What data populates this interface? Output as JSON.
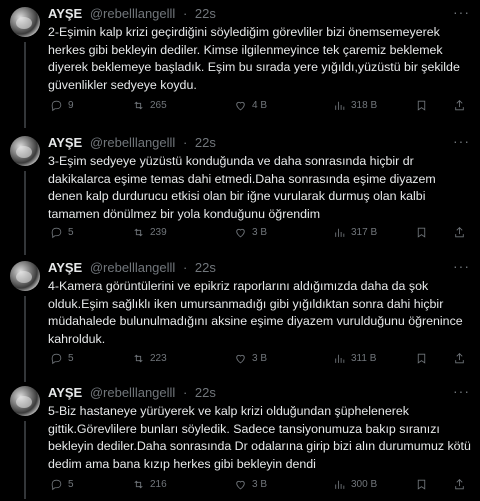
{
  "tweets": [
    {
      "name": "AYŞE",
      "handle": "@rebelllangelll",
      "dot": "·",
      "time": "22s",
      "text": "2-Eşimin kalp krizi geçirdiğini söylediğim görevliler bizi önemsemeyerek herkes gibi bekleyin dediler. Kimse ilgilenmeyince tek çaremiz beklemek diyerek beklemeye başladık. Eşim bu sırada yere yığıldı,yüzüstü bir şekilde güvenlikler sedyeye koydu.",
      "replies": "9",
      "reposts": "265",
      "likes": "4 B",
      "views": "318 B"
    },
    {
      "name": "AYŞE",
      "handle": "@rebelllangelll",
      "dot": "·",
      "time": "22s",
      "text": "3-Eşim sedyeye yüzüstü konduğunda ve daha sonrasında hiçbir dr dakikalarca eşime temas dahi etmedi.Daha sonrasında eşime diyazem denen kalp durdurucu etkisi olan bir iğne vurularak durmuş olan kalbi tamamen dönülmez bir yola konduğunu öğrendim",
      "replies": "5",
      "reposts": "239",
      "likes": "3 B",
      "views": "317 B"
    },
    {
      "name": "AYŞE",
      "handle": "@rebelllangelll",
      "dot": "·",
      "time": "22s",
      "text": "4-Kamera görüntülerini ve epikriz raporlarını aldığımızda daha da şok olduk.Eşim sağlıklı iken umursanmadığı gibi yığıldıktan sonra dahi hiçbir müdahalede bulunulmadığını aksine eşime diyazem vurulduğunu öğrenince kahrolduk.",
      "replies": "5",
      "reposts": "223",
      "likes": "3 B",
      "views": "311 B"
    },
    {
      "name": "AYŞE",
      "handle": "@rebelllangelll",
      "dot": "·",
      "time": "22s",
      "text": "5-Biz hastaneye yürüyerek ve kalp krizi olduğundan şüphelenerek gittik.Görevlilere bunları söyledik. Sadece tansiyonumuza bakıp sıranızı bekleyin dediler.Daha sonrasında Dr odalarına girip bizi alın durumumuz kötü dedim ama bana kızıp herkes gibi bekleyin dendi",
      "replies": "5",
      "reposts": "216",
      "likes": "3 B",
      "views": "300 B"
    }
  ],
  "icons": {
    "reply": "reply-icon",
    "repost": "repost-icon",
    "like": "heart-icon",
    "views": "views-icon",
    "more": "more-icon"
  },
  "colors": {
    "background": "#000000",
    "text": "#e7e9ea",
    "muted": "#71767b",
    "line": "#333639"
  }
}
